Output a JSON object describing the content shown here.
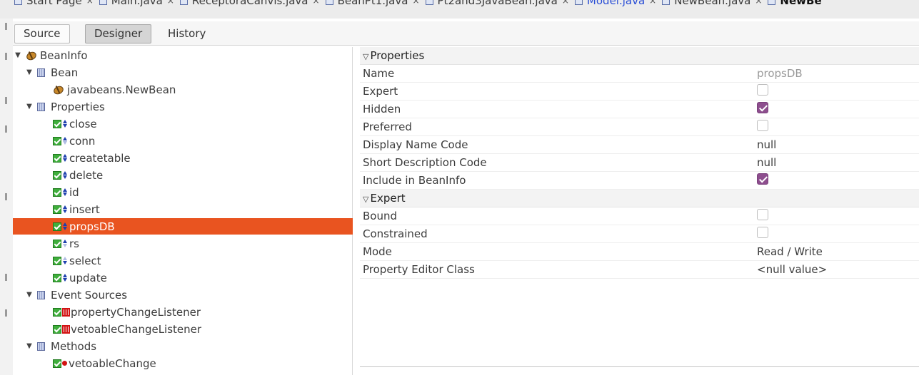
{
  "editor_tabs": [
    {
      "label": "Start Page",
      "state": "normal",
      "icon": "start-page-icon"
    },
    {
      "label": "Main.java",
      "state": "normal",
      "icon": "java-file-icon"
    },
    {
      "label": "ReceptoraCanvis.java",
      "state": "normal",
      "icon": "java-file-icon"
    },
    {
      "label": "BeanPt1.java",
      "state": "normal",
      "icon": "java-file-icon"
    },
    {
      "label": "Pt2and3JavaBean.java",
      "state": "normal",
      "icon": "java-file-icon"
    },
    {
      "label": "Model.java",
      "state": "active",
      "icon": "java-file-icon"
    },
    {
      "label": "NewBean.java",
      "state": "normal",
      "icon": "java-file-icon"
    },
    {
      "label": "NewBe",
      "state": "current",
      "icon": "java-file-icon"
    }
  ],
  "view_switcher": {
    "source": "Source",
    "designer": "Designer",
    "history": "History",
    "selected": "designer"
  },
  "tree": {
    "root": {
      "label": "BeanInfo",
      "icon": "bean-icon",
      "expanded": true
    },
    "bean_group": {
      "label": "Bean",
      "icon": "bean-group-icon",
      "expanded": true
    },
    "bean_item": {
      "label": "javabeans.NewBean",
      "icon": "bean-icon"
    },
    "properties_group": {
      "label": "Properties",
      "icon": "properties-group-icon",
      "expanded": true
    },
    "properties": [
      {
        "label": "close",
        "access": "read-write"
      },
      {
        "label": "conn",
        "access": "read-only"
      },
      {
        "label": "createtable",
        "access": "read-write"
      },
      {
        "label": "delete",
        "access": "read-write"
      },
      {
        "label": "id",
        "access": "read-write"
      },
      {
        "label": "insert",
        "access": "read-write"
      },
      {
        "label": "propsDB",
        "access": "read-write",
        "selected": true
      },
      {
        "label": "rs",
        "access": "read-only"
      },
      {
        "label": "select",
        "access": "write-only"
      },
      {
        "label": "update",
        "access": "read-write"
      }
    ],
    "event_group": {
      "label": "Event Sources",
      "icon": "event-sources-group-icon",
      "expanded": true
    },
    "events": [
      {
        "label": "propertyChangeListener"
      },
      {
        "label": "vetoableChangeListener"
      }
    ],
    "methods_group": {
      "label": "Methods",
      "icon": "methods-group-icon",
      "expanded": true
    },
    "methods": [
      {
        "label": "vetoableChange"
      }
    ]
  },
  "property_sheet": {
    "categories": [
      {
        "label": "Properties",
        "rows": [
          {
            "name": "Name",
            "type": "text",
            "value": "propsDB",
            "muted": true
          },
          {
            "name": "Expert",
            "type": "checkbox",
            "checked": false
          },
          {
            "name": "Hidden",
            "type": "checkbox",
            "checked": true
          },
          {
            "name": "Preferred",
            "type": "checkbox",
            "checked": false
          },
          {
            "name": "Display Name Code",
            "type": "text",
            "value": "null"
          },
          {
            "name": "Short Description Code",
            "type": "text",
            "value": "null"
          },
          {
            "name": "Include in BeanInfo",
            "type": "checkbox",
            "checked": true
          }
        ]
      },
      {
        "label": "Expert",
        "rows": [
          {
            "name": "Bound",
            "type": "checkbox",
            "checked": false
          },
          {
            "name": "Constrained",
            "type": "checkbox",
            "checked": false
          },
          {
            "name": "Mode",
            "type": "text",
            "value": "Read / Write"
          },
          {
            "name": "Property Editor Class",
            "type": "text",
            "value": "<null value>"
          }
        ]
      }
    ]
  },
  "colors": {
    "selection": "#e95420",
    "checkbox_on": "#8d4e8e",
    "active_tab": "#2b4fd6"
  }
}
